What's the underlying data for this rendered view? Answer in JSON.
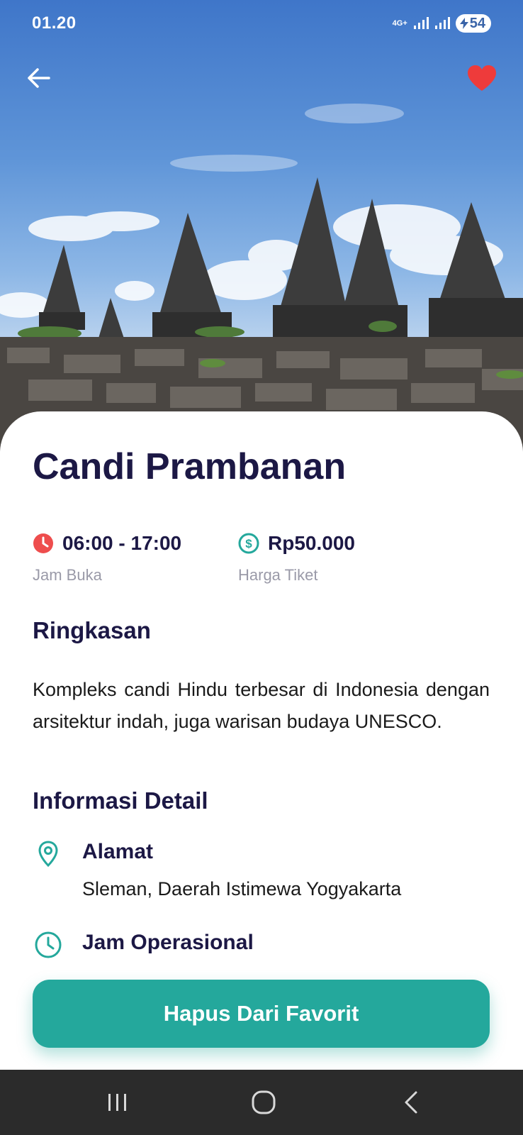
{
  "status_bar": {
    "time": "01.20",
    "network": "4G+",
    "battery": "54"
  },
  "hero": {
    "image_icon": "temple-photo",
    "back_icon": "arrow-left-icon",
    "favorite_icon": "heart-icon",
    "favorite_color": "#ee3b3b"
  },
  "place": {
    "title": "Candi Prambanan",
    "hours_value": "06:00 - 17:00",
    "hours_label": "Jam Buka",
    "price_value": "Rp50.000",
    "price_label": "Harga Tiket"
  },
  "summary": {
    "heading": "Ringkasan",
    "text": "Kompleks candi Hindu terbesar di Indonesia dengan arsitektur indah, juga warisan budaya UNESCO."
  },
  "details": {
    "heading": "Informasi Detail",
    "address_label": "Alamat",
    "address_value": "Sleman, Daerah Istimewa Yogyakarta",
    "hours_label": "Jam Operasional"
  },
  "actions": {
    "remove_label": "Hapus Dari Favorit"
  },
  "colors": {
    "primary": "#24a89c",
    "title": "#1c1845",
    "clock_icon_red": "#ee4d4d"
  }
}
